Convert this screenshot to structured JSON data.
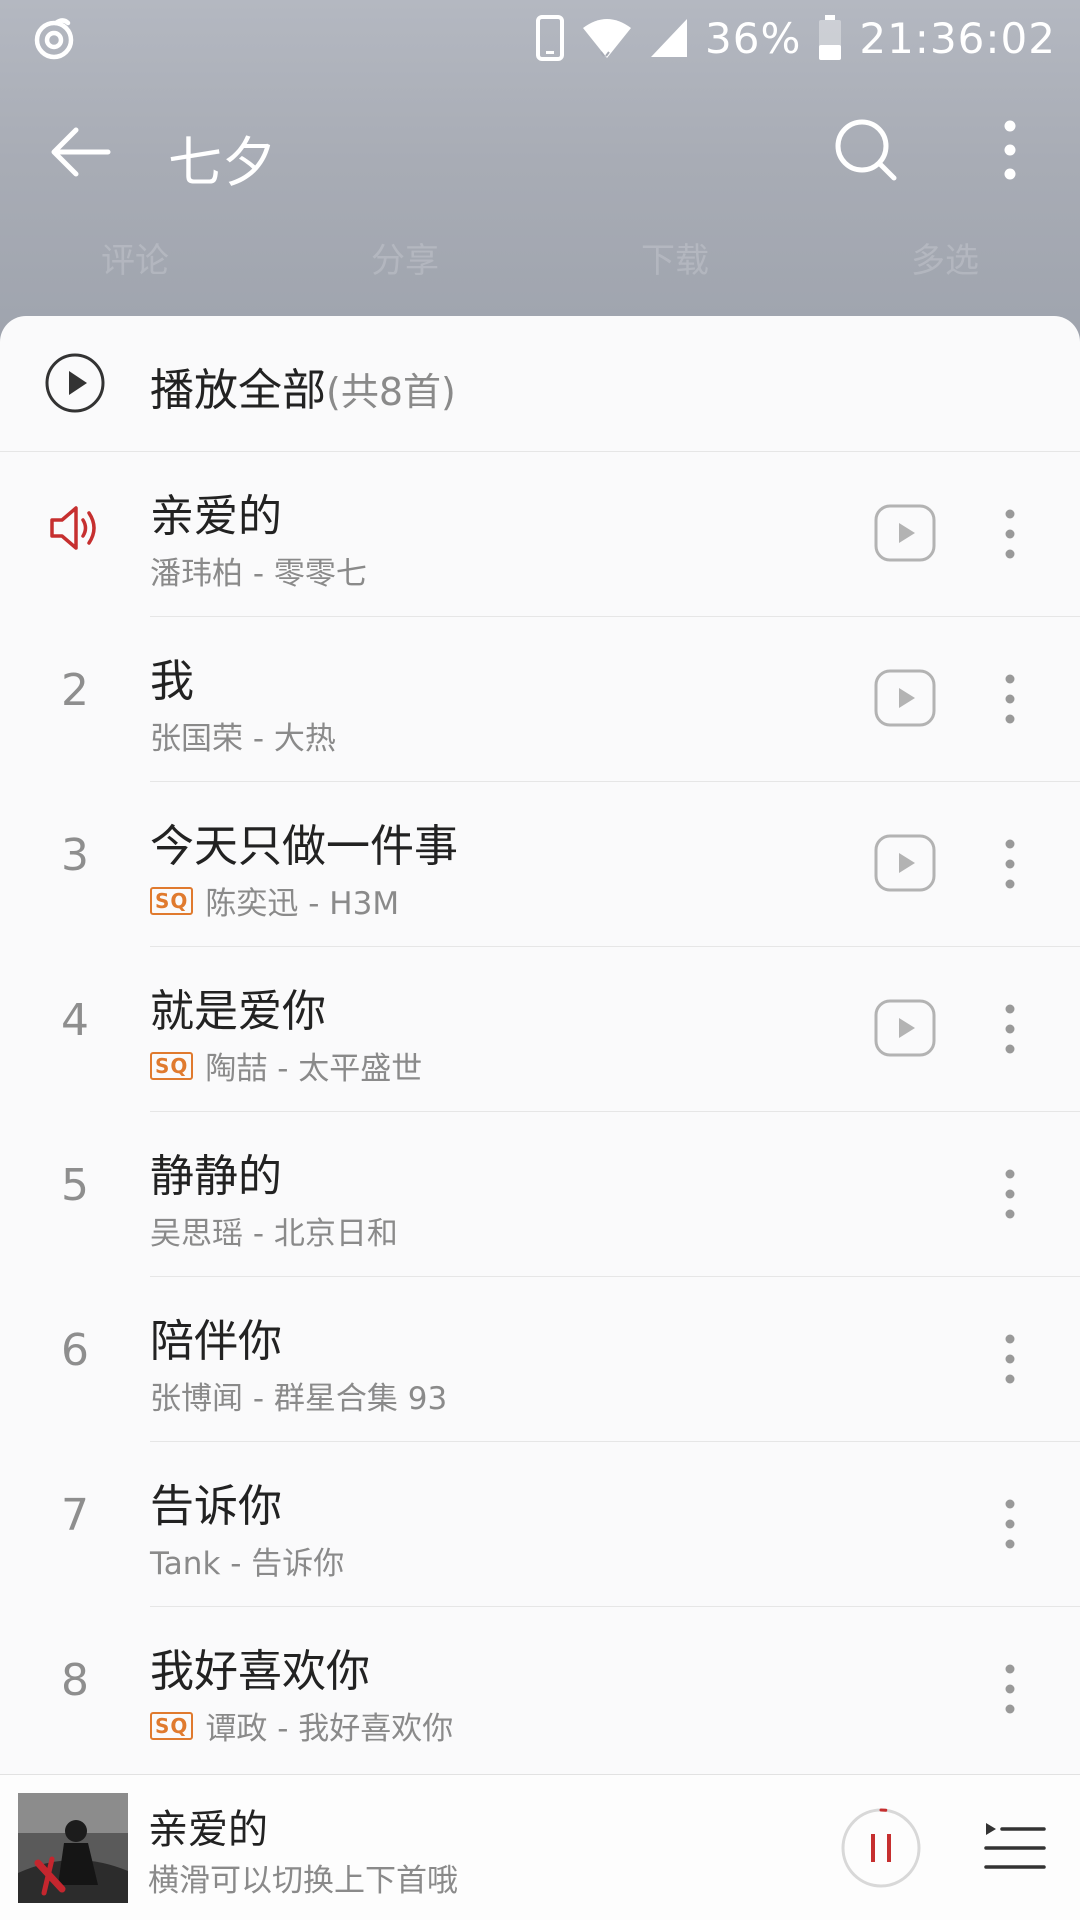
{
  "status_bar": {
    "battery": "36%",
    "time": "21:36:02"
  },
  "header": {
    "title": "七夕"
  },
  "actions": [
    "评论",
    "分享",
    "下载",
    "多选"
  ],
  "play_all": {
    "label": "播放全部",
    "count": "(共8首)"
  },
  "songs": [
    {
      "index": "",
      "playing": true,
      "title": "亲爱的",
      "subtitle": "潘玮柏 - 零零七",
      "sq": false,
      "mv": true
    },
    {
      "index": "2",
      "playing": false,
      "title": "我",
      "subtitle": "张国荣 - 大热",
      "sq": false,
      "mv": true
    },
    {
      "index": "3",
      "playing": false,
      "title": "今天只做一件事",
      "subtitle": "陈奕迅 - H3M",
      "sq": true,
      "mv": true
    },
    {
      "index": "4",
      "playing": false,
      "title": "就是爱你",
      "subtitle": "陶喆 - 太平盛世",
      "sq": true,
      "mv": true
    },
    {
      "index": "5",
      "playing": false,
      "title": "静静的",
      "subtitle": "吴思瑶 - 北京日和",
      "sq": false,
      "mv": false
    },
    {
      "index": "6",
      "playing": false,
      "title": "陪伴你",
      "subtitle": "张博闻 - 群星合集 93",
      "sq": false,
      "mv": false
    },
    {
      "index": "7",
      "playing": false,
      "title": "告诉你",
      "subtitle": "Tank - 告诉你",
      "sq": false,
      "mv": false
    },
    {
      "index": "8",
      "playing": false,
      "title": "我好喜欢你",
      "subtitle": "谭政 - 我好喜欢你",
      "sq": true,
      "mv": false
    }
  ],
  "sq_badge": "SQ",
  "player": {
    "title": "亲爱的",
    "hint": "横滑可以切换上下首哦",
    "progress": 0.02,
    "accent_color": "#c62f2f"
  },
  "colors": {
    "accent": "#c62f2f",
    "sq": "#e07a2e"
  }
}
